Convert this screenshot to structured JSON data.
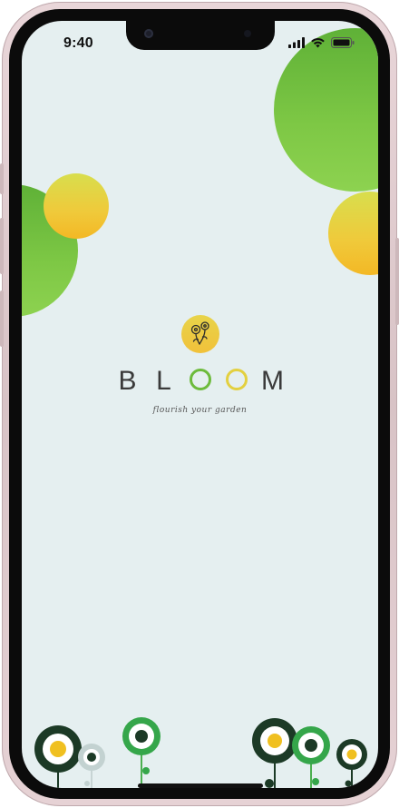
{
  "status_bar": {
    "time": "9:40",
    "icons": [
      "cellular-signal-icon",
      "wifi-icon",
      "battery-icon"
    ]
  },
  "app": {
    "brand_letters": [
      "B",
      "L",
      "O",
      "O",
      "M"
    ],
    "brand_name": "BLOOM",
    "tagline": "flourish your garden",
    "logo_icon": "flower-pair-icon"
  },
  "colors": {
    "screen_background": "#e5eff0",
    "brand_green": "#6dbb3c",
    "brand_yellow": "#f0c93a",
    "dark_green": "#1c3a26",
    "text_dark": "#3a3a3a"
  }
}
